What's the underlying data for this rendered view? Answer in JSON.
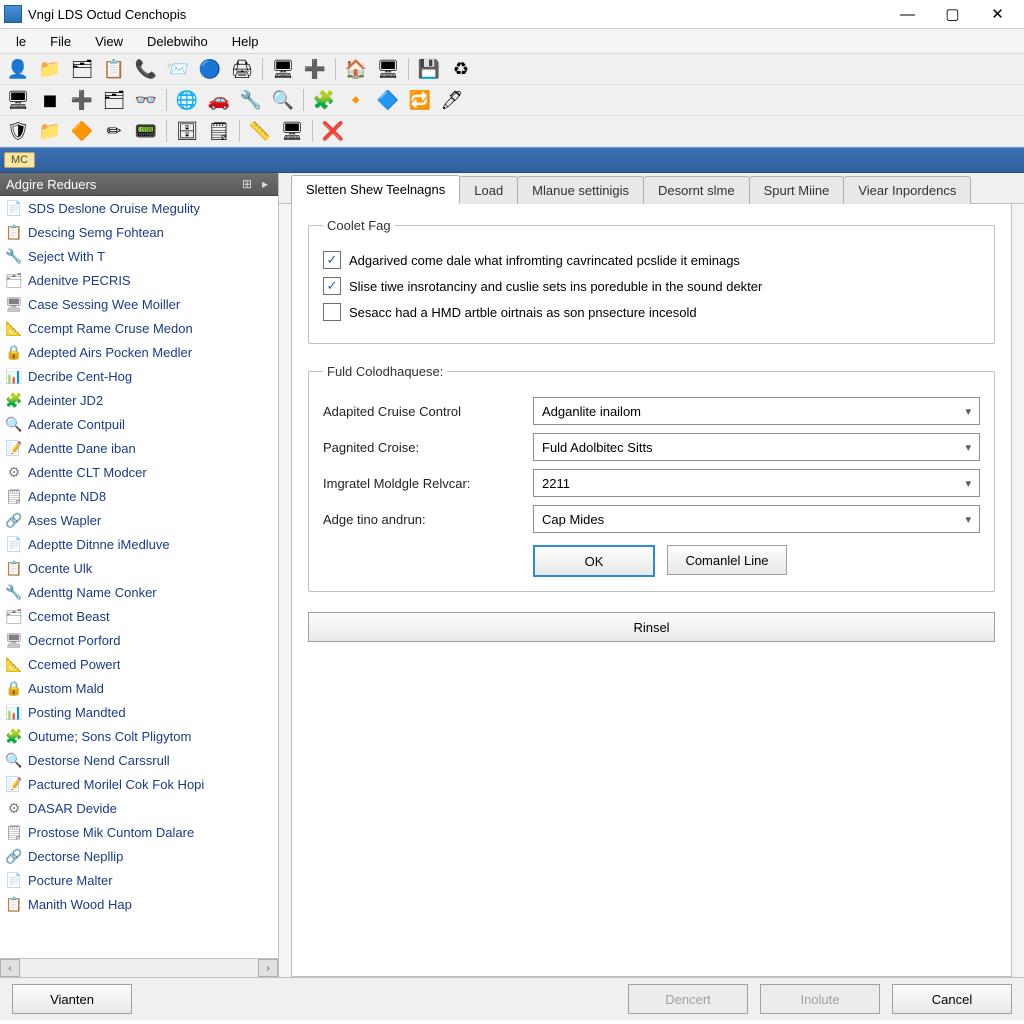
{
  "window": {
    "title": "Vngi LDS Octud Cenchopis"
  },
  "menu": {
    "items": [
      "le",
      "File",
      "View",
      "Delebwiho",
      "Help"
    ]
  },
  "toolbar_rows": [
    [
      "👤",
      "📁",
      "🗂",
      "📋",
      "📞",
      "📨",
      "🔵",
      "🖨",
      "🖥",
      "➕",
      "🏠",
      "🖥",
      "",
      "💾",
      "♻"
    ],
    [
      "🖥",
      "◼",
      "➕",
      "🗂",
      "👓",
      "",
      "🌐",
      "🚗",
      "🔧",
      "🔍",
      "",
      "🧩",
      "🔸",
      "🔷",
      "🔁",
      "🖊",
      ""
    ],
    [
      "🛡",
      "📁",
      "🔶",
      "✏",
      "📟",
      "",
      "🗄",
      "🗒",
      "",
      "📏",
      "🖥",
      "",
      "❌"
    ]
  ],
  "blueband": {
    "chip": "MC"
  },
  "sidebar": {
    "header": "Adgire Reduers",
    "items": [
      "SDS Deslone Oruise Megulity",
      "Descing Semg Fohtean",
      "Seject With T",
      "Adenitve PECRIS",
      "Case Sessing Wee Moiller",
      "Ccempt Rame Cruse Medon",
      "Adepted Airs Pocken Medler",
      "Decribe Cent-Hog",
      "Adeinter JD2",
      "Aderate Contpuil",
      "Adentte Dane iban",
      "Adentte CLT Modcer",
      "Adepnte ND8",
      "Ases Wapler",
      "Adeptte Ditnne iMedluve",
      "Ocente Ulk",
      "Adenttg Name Conker",
      "Ccemot Beast",
      "Oecrnot Porford",
      "Ccemed Powert",
      "Austom Mald",
      "Posting Mandted",
      "Outume; Sons Colt Pligytom",
      "Destorse Nend Carssrull",
      "Pactured Morilel Cok Fok Hopi",
      "DASAR Devide",
      "Prostose Mik Cuntom Dalare",
      "Dectorse Nepllip",
      "Pocture Malter",
      "Manith Wood Hap"
    ]
  },
  "tabs": {
    "items": [
      "Sletten Shew Teelnagns",
      "Load",
      "Mlanue settinigis",
      "Desornt slme",
      "Spurt Miine",
      "Viear Inpordencs"
    ],
    "active_index": 0
  },
  "group1": {
    "legend": "Coolet Fag",
    "checks": [
      {
        "checked": true,
        "label": "Adgarived come dale what infromting cavrincated pcslide it eminags"
      },
      {
        "checked": true,
        "label": "Slise tiwe insrotanciny and cuslie sets ins poreduble in the sound dekter"
      },
      {
        "checked": false,
        "label": "Sesacc had a HMD artble oirtnais as son pnsecture incesold"
      }
    ]
  },
  "group2": {
    "legend": "Fuld Colodhaquese:",
    "rows": [
      {
        "label": "Adapited Cruise Control",
        "value": "Adganlite inailom"
      },
      {
        "label": "Pagnited Croise:",
        "value": "Fuld Adolbitec Sitts"
      },
      {
        "label": "Imgratel Moldgle Relvcar:",
        "value": "2211"
      },
      {
        "label": "Adge tino andrun:",
        "value": "Cap Mides"
      }
    ],
    "ok_label": "OK",
    "secondary_label": "Comanlel Line"
  },
  "reset_label": "Rinsel",
  "footer": {
    "left": "Vianten",
    "mid1": "Dencert",
    "mid2": "Inolute",
    "cancel": "Cancel"
  }
}
